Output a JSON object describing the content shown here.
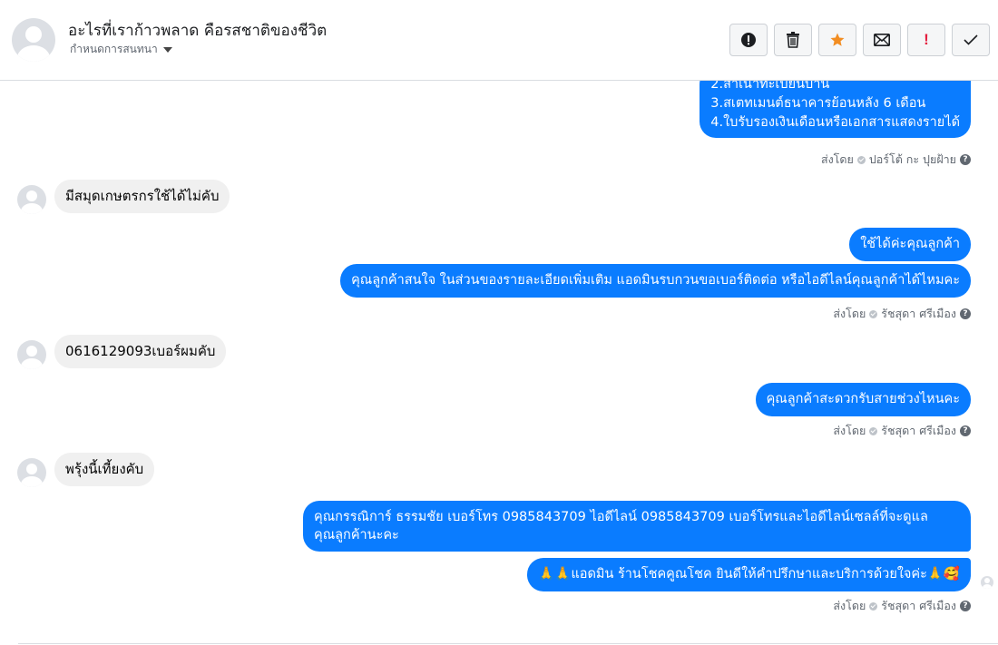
{
  "header": {
    "title": "อะไรที่เราก้าวพลาด คือรสชาติของชีวิต",
    "subtitle": "กำหนดการสนทนา",
    "actions": [
      {
        "name": "report-icon",
        "label": "Report"
      },
      {
        "name": "trash-icon",
        "label": "Delete"
      },
      {
        "name": "star-icon",
        "label": "Star"
      },
      {
        "name": "envelope-icon",
        "label": "Mark unread"
      },
      {
        "name": "exclamation-icon",
        "label": "!"
      },
      {
        "name": "check-icon",
        "label": "Done"
      }
    ]
  },
  "messages": {
    "m1_lines": [
      "2.สำเนาทะเบียนบ้าน",
      "3.สเตทเมนต์ธนาคารย้อนหลัง 6 เดือน",
      "4.ใบรับรองเงินเดือนหรือเอกสารแสดงรายได้"
    ],
    "m1_sent": "ส่งโดย",
    "m1_sender": "ปอร์โต้ กะ ปุยฝ้าย",
    "m2": "มีสมุดเกษตรกรใช้ได้ไม่คับ",
    "m3": "ใช้ได้ค่ะคุณลูกค้า",
    "m4": "คุณลูกค้าสนใจ ในส่วนของรายละเอียดเพิ่มเติม แอดมินรบกวนขอเบอร์ติดต่อ หรือไอดีไลน์คุณลูกค้าได้ไหมคะ",
    "m4_sent": "ส่งโดย",
    "m4_sender": "รัชสุดา ศรีเมือง",
    "m5": "0616129093เบอร์ผมคับ",
    "m6": "คุณลูกค้าสะดวกรับสายช่วงไหนคะ",
    "m6_sent": "ส่งโดย",
    "m6_sender": "รัชสุดา ศรีเมือง",
    "m7": "พรุ้งนี้เที้ยงคับ",
    "m8_line1": "คุณกรรณิการ์ ธรรมชัย     เบอร์โทร 0985843709  ไอดีไลน์ 0985843709   เบอร์โทรและไอดีไลน์เซลล์ที่จะดูแล",
    "m8_line2": "คุณลูกค้านะคะ",
    "m9": "🙏🙏แอดมิน ร้านโชคคูณโชค ยินดีให้คำปรึกษาและบริการด้วยใจค่ะ🙏🥰",
    "m9_sent": "ส่งโดย",
    "m9_sender": "รัชสุดา ศรีเมือง"
  },
  "colors": {
    "outgoing_bubble": "#0a7cff",
    "incoming_bubble": "#f0f0f0",
    "star": "#f28d22",
    "alert": "#e41e3f"
  }
}
